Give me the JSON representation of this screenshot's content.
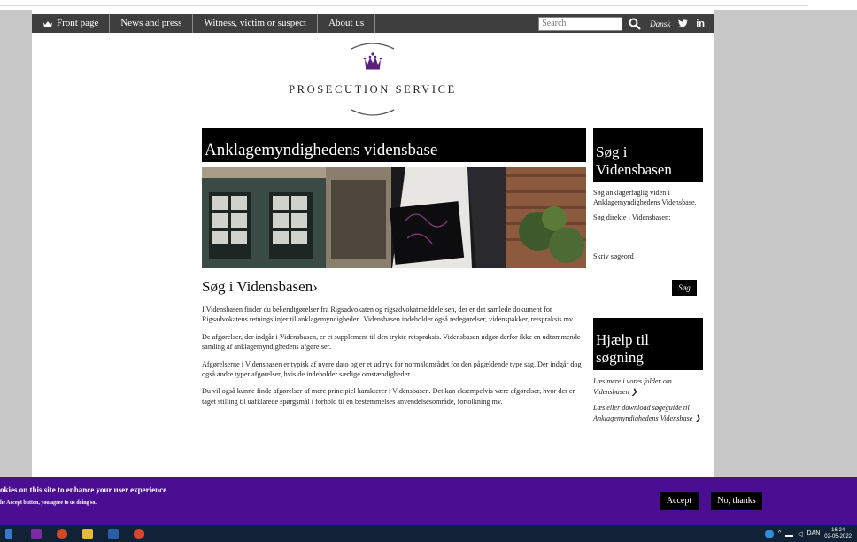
{
  "nav": {
    "items": [
      "Front page",
      "News and press",
      "Witness, victim or suspect",
      "About us"
    ],
    "search_placeholder": "Search",
    "language": "Dansk",
    "linkedin": "in"
  },
  "logo": {
    "title": "PROSECUTION SERVICE"
  },
  "hero": {
    "title": "Anklagemyndighedens vidensbase"
  },
  "main": {
    "heading": "Søg i Vidensbasen",
    "heading_arrow": "›",
    "paragraphs": [
      "I Vidensbasen finder du bekendtgørelser fra Rigsadvokaten og rigsadvokatmeddelelsen, der er det samlede dokument for Rigsadvokatens retningslinjer til anklagemyndigheden. Vidensbasen indeholder også redegørelser, videnspakker, retspraksis mv.",
      "De afgørelser, der indgår i Vidensbasen, er et supplement til den trykte retspraksis. Vidensbasen udgør derfor ikke en udtømmende samling af anklagemyndighedens afgørelser.",
      "Afgørelserne i Vidensbasen er typisk af nyere dato og er et udtryk for normalområdet for den pågældende type sag. Der indgår dog også andre typer afgørelser, hvis de indeholder særlige omstændigheder.",
      "Du vil også kunne finde afgørelser af mere principiel karakterer i Vidensbasen. Det kan eksempelvis være afgørelser, hvor der er taget stilling til uafklarede spørgsmål i forhold til en bestemmelses anvendelsesområde, fortolkning mv."
    ]
  },
  "sidebar_search": {
    "title": "Søg i Vidensbasen",
    "description": "Søg anklagerfaglig viden i Anklagemyndighedens Vidensbase.",
    "direct": "Søg direkte i Vidensbasen:",
    "label": "Skriv søgeord",
    "button": "Søg"
  },
  "sidebar_help": {
    "title": "Hjælp til søgning",
    "link1": "Læs mere i vores folder om Vidensbasen",
    "link2": "Læs eller download søgeguide til Anklagemyndighedens Vidensbase",
    "arrow": "❯"
  },
  "cookie": {
    "heading": "okies on this site to enhance your user experience",
    "subtext": "he Accept button, you agree to us doing so.",
    "accept": "Accept",
    "decline": "No, thanks"
  },
  "taskbar": {
    "tray_lang": "DAN",
    "time": "16:24",
    "date": "02-05-2022"
  },
  "colors": {
    "nav_bg": "#3e3e3e",
    "cookie_bg": "#4a0e92",
    "brand_purple": "#5a1f7a",
    "taskbar_bg": "#122236"
  }
}
